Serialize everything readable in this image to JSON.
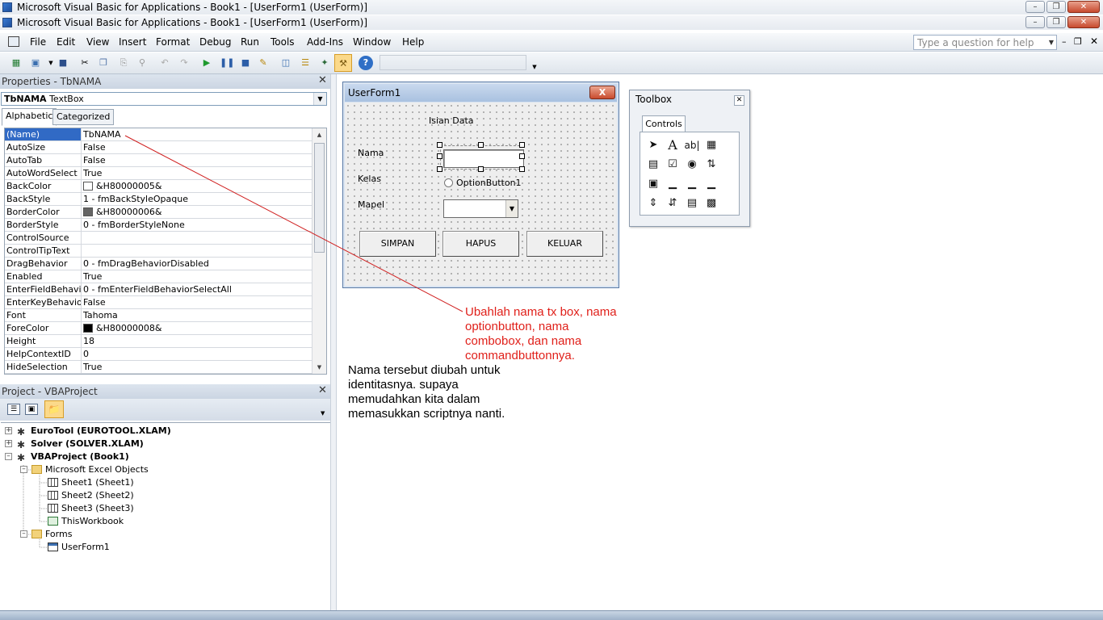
{
  "windows": {
    "excel_title": "Microsoft Visual Basic for Applications - Book1 - [UserForm1 (UserForm)]",
    "vbe_title": "Microsoft Visual Basic for Applications - Book1 - [UserForm1 (UserForm)]"
  },
  "menu": {
    "items": [
      "File",
      "Edit",
      "View",
      "Insert",
      "Format",
      "Debug",
      "Run",
      "Tools",
      "Add-Ins",
      "Window",
      "Help"
    ],
    "help_placeholder": "Type a question for help"
  },
  "properties": {
    "title": "Properties - TbNAMA",
    "object_name": "TbNAMA",
    "object_type": "TextBox",
    "tabs": [
      "Alphabetic",
      "Categorized"
    ],
    "rows": [
      {
        "name": "(Name)",
        "value": "TbNAMA"
      },
      {
        "name": "AutoSize",
        "value": "False"
      },
      {
        "name": "AutoTab",
        "value": "False"
      },
      {
        "name": "AutoWordSelect",
        "value": "True"
      },
      {
        "name": "BackColor",
        "value": "&H80000005&",
        "swatch": "#ffffff"
      },
      {
        "name": "BackStyle",
        "value": "1 - fmBackStyleOpaque"
      },
      {
        "name": "BorderColor",
        "value": "&H80000006&",
        "swatch": "#646464"
      },
      {
        "name": "BorderStyle",
        "value": "0 - fmBorderStyleNone"
      },
      {
        "name": "ControlSource",
        "value": ""
      },
      {
        "name": "ControlTipText",
        "value": ""
      },
      {
        "name": "DragBehavior",
        "value": "0 - fmDragBehaviorDisabled"
      },
      {
        "name": "Enabled",
        "value": "True"
      },
      {
        "name": "EnterFieldBehavior",
        "value": "0 - fmEnterFieldBehaviorSelectAll"
      },
      {
        "name": "EnterKeyBehavior",
        "value": "False"
      },
      {
        "name": "Font",
        "value": "Tahoma"
      },
      {
        "name": "ForeColor",
        "value": "&H80000008&",
        "swatch": "#000000"
      },
      {
        "name": "Height",
        "value": "18"
      },
      {
        "name": "HelpContextID",
        "value": "0"
      },
      {
        "name": "HideSelection",
        "value": "True"
      }
    ]
  },
  "project": {
    "title": "Project - VBAProject",
    "eurotool": "EuroTool (EUROTOOL.XLAM)",
    "solver": "Solver (SOLVER.XLAM)",
    "vbaproject": "VBAProject (Book1)",
    "excel_objects": "Microsoft Excel Objects",
    "sheet1": "Sheet1 (Sheet1)",
    "sheet2": "Sheet2 (Sheet2)",
    "sheet3": "Sheet3 (Sheet3)",
    "thisworkbook": "ThisWorkbook",
    "forms": "Forms",
    "userform1": "UserForm1"
  },
  "userform": {
    "title": "UserForm1",
    "close": "X",
    "heading": "Isian Data",
    "label_nama": "Nama",
    "label_kelas": "Kelas",
    "label_mapel": "Mapel",
    "option_label": "OptionButton1",
    "btn_simpan": "SIMPAN",
    "btn_hapus": "HAPUS",
    "btn_keluar": "KELUAR"
  },
  "toolbox": {
    "title": "Toolbox",
    "tab": "Controls"
  },
  "annotations": {
    "red": "Ubahlah nama tx box, nama optionbutton, nama combobox, dan nama commandbuttonnya.",
    "black": "Nama tersebut diubah untuk identitasnya. supaya memudahkan kita dalam memasukkan scriptnya nanti."
  },
  "colors": {
    "selection": "#316ac5",
    "annotation_red": "#e0201a"
  }
}
